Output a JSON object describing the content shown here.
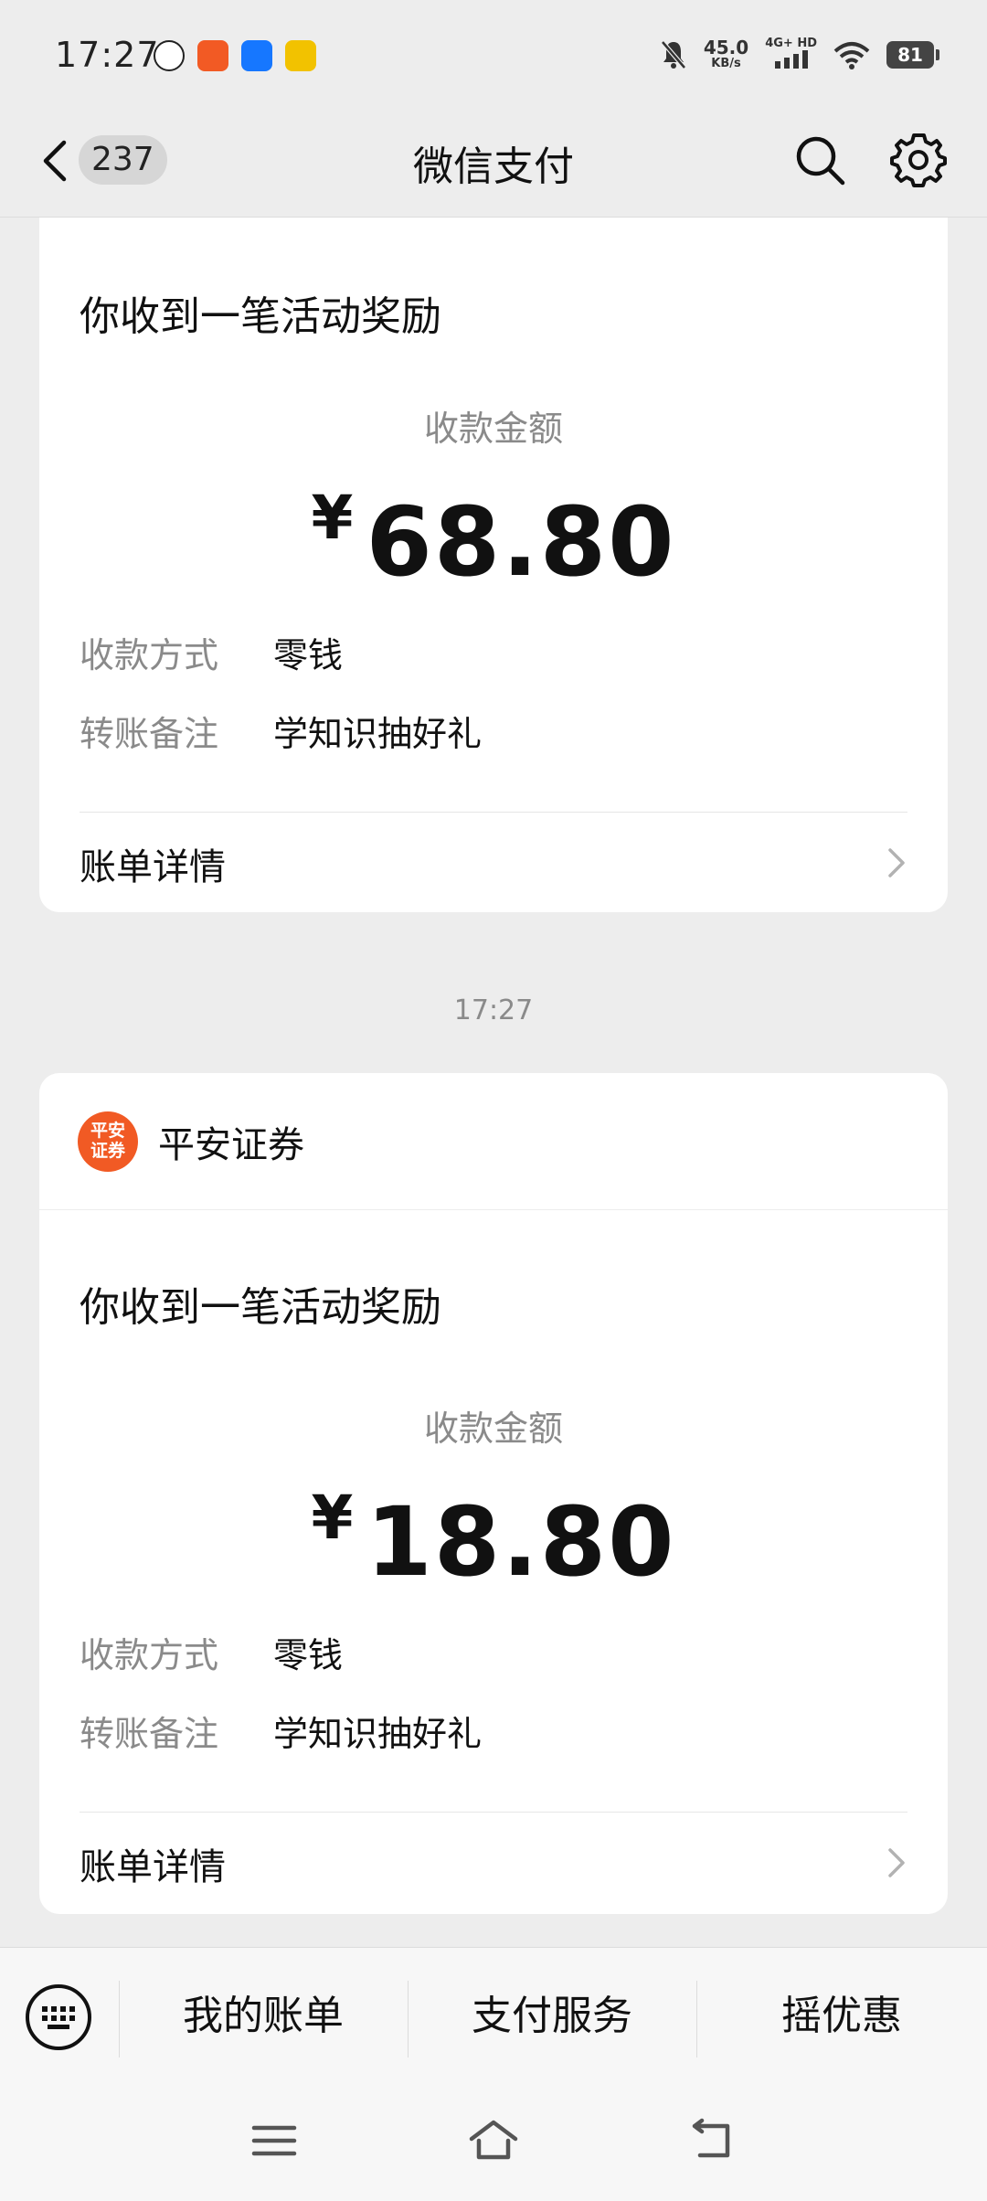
{
  "status_bar": {
    "time": "17:27",
    "net_speed": "45.0",
    "net_unit": "KB/s",
    "net_type": "4G+ HD",
    "battery": "81"
  },
  "nav": {
    "back_count": "237",
    "title": "微信支付"
  },
  "cards": [
    {
      "title": "你收到一笔活动奖励",
      "amount_label": "收款金额",
      "currency": "¥",
      "amount": "68.80",
      "method_label": "收款方式",
      "method_value": "零钱",
      "note_label": "转账备注",
      "note_value": "学知识抽好礼",
      "detail_label": "账单详情"
    },
    {
      "merchant_logo_text": "平安证券",
      "merchant_name": "平安证券",
      "title": "你收到一笔活动奖励",
      "amount_label": "收款金额",
      "currency": "¥",
      "amount": "18.80",
      "method_label": "收款方式",
      "method_value": "零钱",
      "note_label": "转账备注",
      "note_value": "学知识抽好礼",
      "detail_label": "账单详情"
    }
  ],
  "timestamp": "17:27",
  "bottom_menu": {
    "items": [
      "我的账单",
      "支付服务",
      "摇优惠"
    ]
  },
  "icons": {
    "back": "chevron-left-icon",
    "search": "search-icon",
    "settings": "gear-icon",
    "keyboard": "keyboard-icon",
    "detail": "chevron-right-icon",
    "sys_menu": "menu-icon",
    "sys_home": "home-icon",
    "sys_back": "back-icon"
  },
  "colors": {
    "background": "#ededed",
    "card": "#ffffff",
    "merchant_logo": "#f15a24",
    "secondary_text": "#8a8a8a"
  }
}
